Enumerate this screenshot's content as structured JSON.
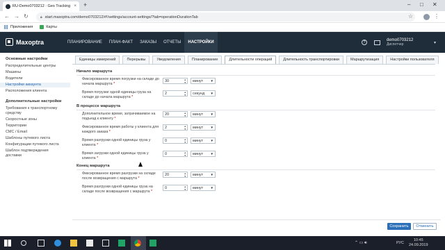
{
  "browser": {
    "tab_title": "RU-Demo0703212 : Geo Tracking",
    "tab_close": "×",
    "new_tab": "+",
    "url": "start.maxoptra.com/demo0703212/#!/settings/account-settings/?tab=operationDurationTab",
    "bookmarks": [
      "Приложения",
      "Карты"
    ]
  },
  "app": {
    "logo": "Maxoptra",
    "nav": [
      "ПЛАНИРОВАНИЕ",
      "ПЛАН-ФАКТ",
      "ЗАКАЗЫ",
      "ОТЧЕТЫ",
      "НАСТРОЙКИ"
    ],
    "active_nav": "НАСТРОЙКИ",
    "user_name": "demo0703212",
    "user_role": "Диспетчер"
  },
  "sidebar": {
    "group1_title": "Основные настройки",
    "group1_items": [
      "Распределительные центры",
      "Машины",
      "Водители",
      "Настройки аккаунта",
      "Расположения клиента"
    ],
    "active_item": "Настройки аккаунта",
    "group2_title": "Дополнительные настройки",
    "group2_items": [
      "Требования к транспортному средству",
      "Скоростные зоны",
      "Территории",
      "СМС / Email",
      "Шаблоны путевого листа",
      "Конфигурации путевого листа",
      "Шаблон подтверждения доставки"
    ]
  },
  "subtabs": [
    "Единицы измерений",
    "Перерывы",
    "Уведомления",
    "Планирование",
    "Длительности операций",
    "Длительность транспортировки",
    "Маршрутизация",
    "Настройки пользователя"
  ],
  "active_subtab": "Длительности операций",
  "sections": {
    "start": {
      "title": "Начало маршрута",
      "fields": [
        {
          "label": "Фиксированное время погрузки на складе до начала маршрута",
          "value": "30",
          "unit": "минут"
        },
        {
          "label": "Время погрузки одной единицы груза на складе до начала маршрута",
          "value": "2",
          "unit": "секунд"
        }
      ]
    },
    "process": {
      "title": "В процессе маршрута",
      "fields": [
        {
          "label": "Дополнительное время, затрачиваемое на подъезд к клиенту",
          "value": "20",
          "unit": "минут"
        },
        {
          "label": "Фиксированное время работы у клиента для каждого заказа",
          "value": "2",
          "unit": "минут"
        },
        {
          "label": "Время разгрузки одной единицы груза у клиента",
          "value": "0",
          "unit": "минут"
        },
        {
          "label": "Время загрузки одной единицы груза у клиента",
          "value": "0",
          "unit": "минут"
        }
      ]
    },
    "end": {
      "title": "Конец маршрута",
      "fields": [
        {
          "label": "Фиксированное время разгрузки на складе после возвращения с маршрута",
          "value": "20",
          "unit": "минут"
        },
        {
          "label": "Время разгрузки одной единицы груза на складе после возвращения с маршрута",
          "value": "0",
          "unit": "минут"
        }
      ]
    }
  },
  "buttons": {
    "save": "Сохранить",
    "cancel": "Отменить"
  },
  "taskbar": {
    "lang": "РУС",
    "time": "10:45",
    "date": "24.09.2019"
  }
}
